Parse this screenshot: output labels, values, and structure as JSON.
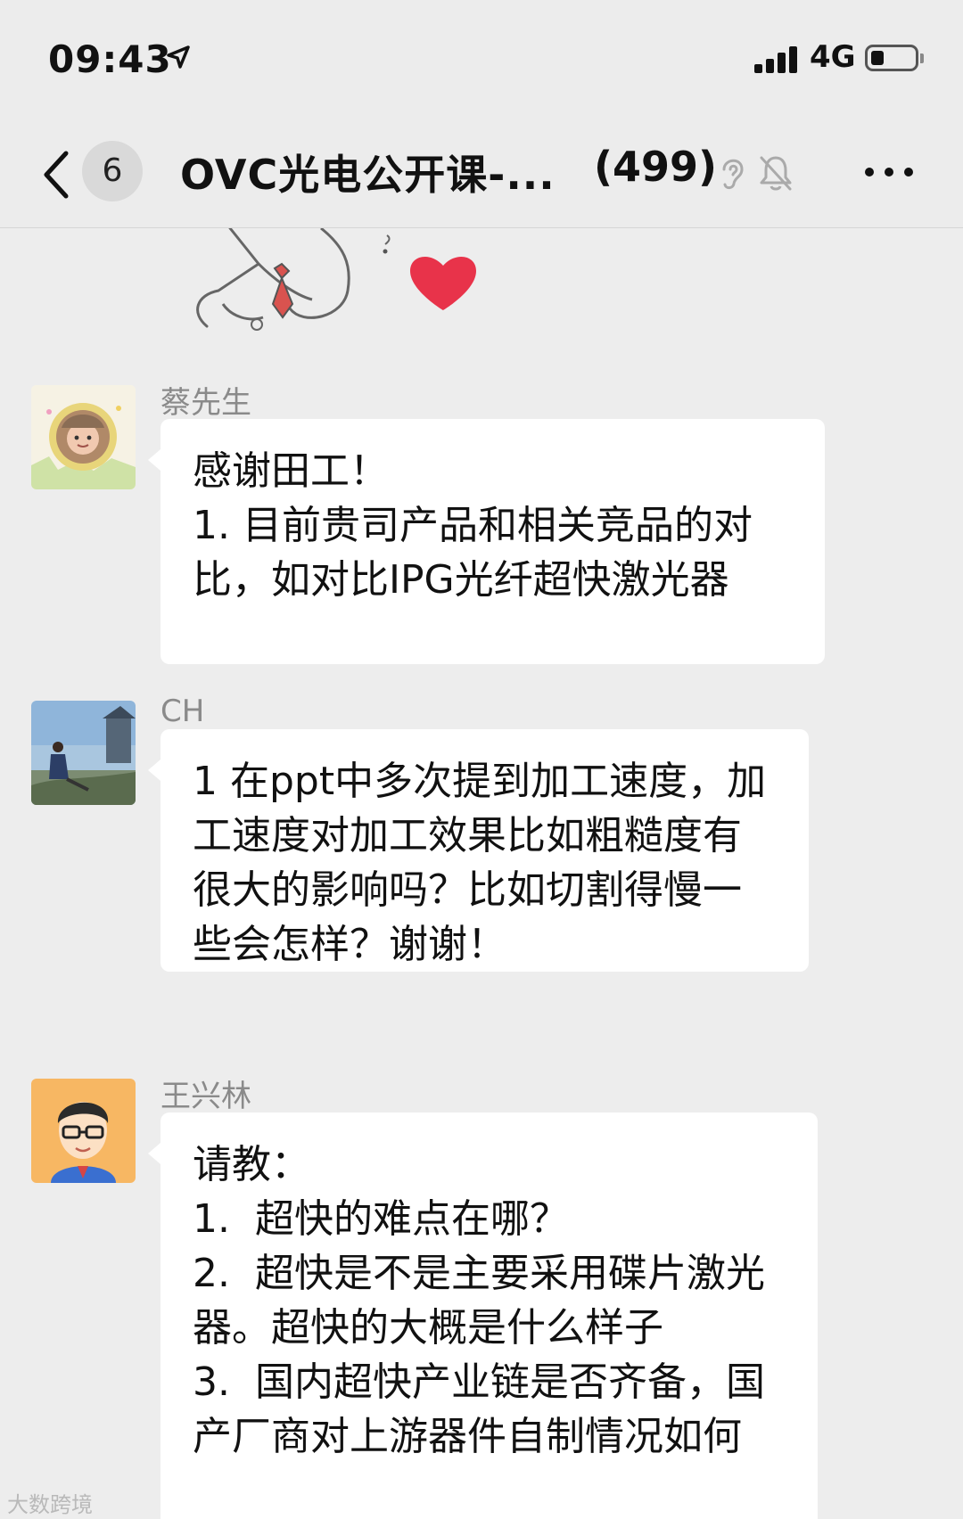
{
  "status_bar": {
    "time": "09:43",
    "network": "4G",
    "battery_level": 0.3
  },
  "nav": {
    "back_badge": "6",
    "title": "OVC光电公开课-...",
    "member_count": "(499)"
  },
  "messages": [
    {
      "sender": "蔡先生",
      "text": "感谢田工！\n1. 目前贵司产品和相关竞品的对比，如对比IPG光纤超快激光器"
    },
    {
      "sender": "CH",
      "text": "1 在ppt中多次提到加工速度，加工速度对加工效果比如粗糙度有很大的影响吗？比如切割得慢一些会怎样？谢谢！"
    },
    {
      "sender": "王兴林",
      "text": "请教：\n1.  超快的难点在哪？\n2.  超快是不是主要采用碟片激光器。超快的大概是什么样子\n3.  国内超快产业链是否齐备，国产厂商对上游器件自制情况如何"
    }
  ],
  "watermark": "大数跨境",
  "colors": {
    "background": "#ededed",
    "bubble": "#ffffff",
    "sender_name": "#8a8a8a",
    "heart": "#e8334a"
  }
}
